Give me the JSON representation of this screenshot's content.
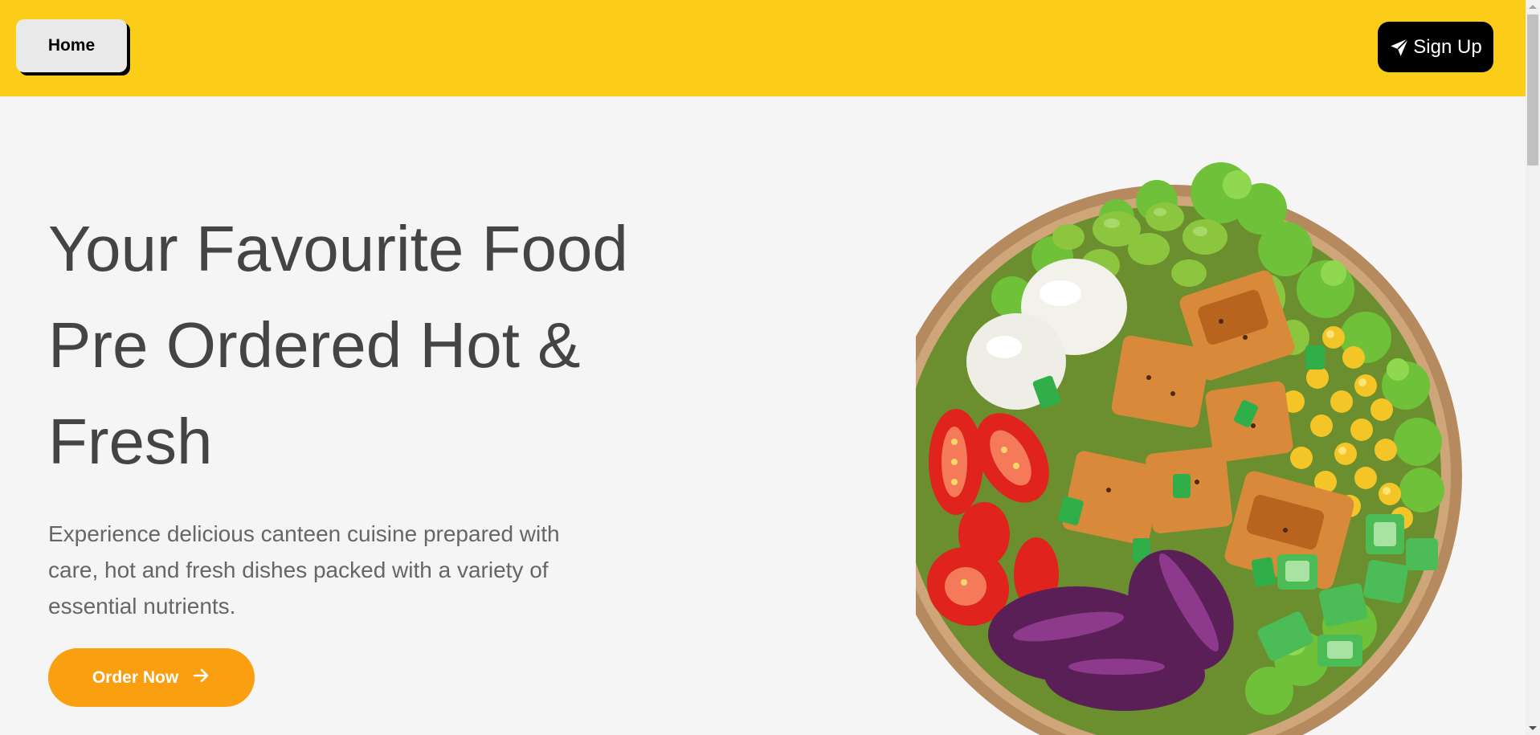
{
  "nav": {
    "home_label": "Home",
    "signup_label": "Sign Up",
    "signup_icon": "paper-plane-icon"
  },
  "hero": {
    "title_line1": "Your Favourite Food",
    "title_line2": "Pre Ordered Hot &",
    "title_line3": "Fresh",
    "description": "Experience delicious canteen cuisine prepared with care, hot and fresh dishes packed with a variety of essential nutrients.",
    "cta_label": "Order Now",
    "cta_icon": "arrow-right-icon",
    "image": "salad-bowl-image"
  },
  "colors": {
    "header_bg": "#fbcd19",
    "page_bg": "#f5f5f5",
    "cta_bg": "#fa9f0f",
    "signup_bg": "#000000",
    "home_bg": "#e9e9e9",
    "heading_text": "#444444",
    "body_text": "#666666"
  }
}
